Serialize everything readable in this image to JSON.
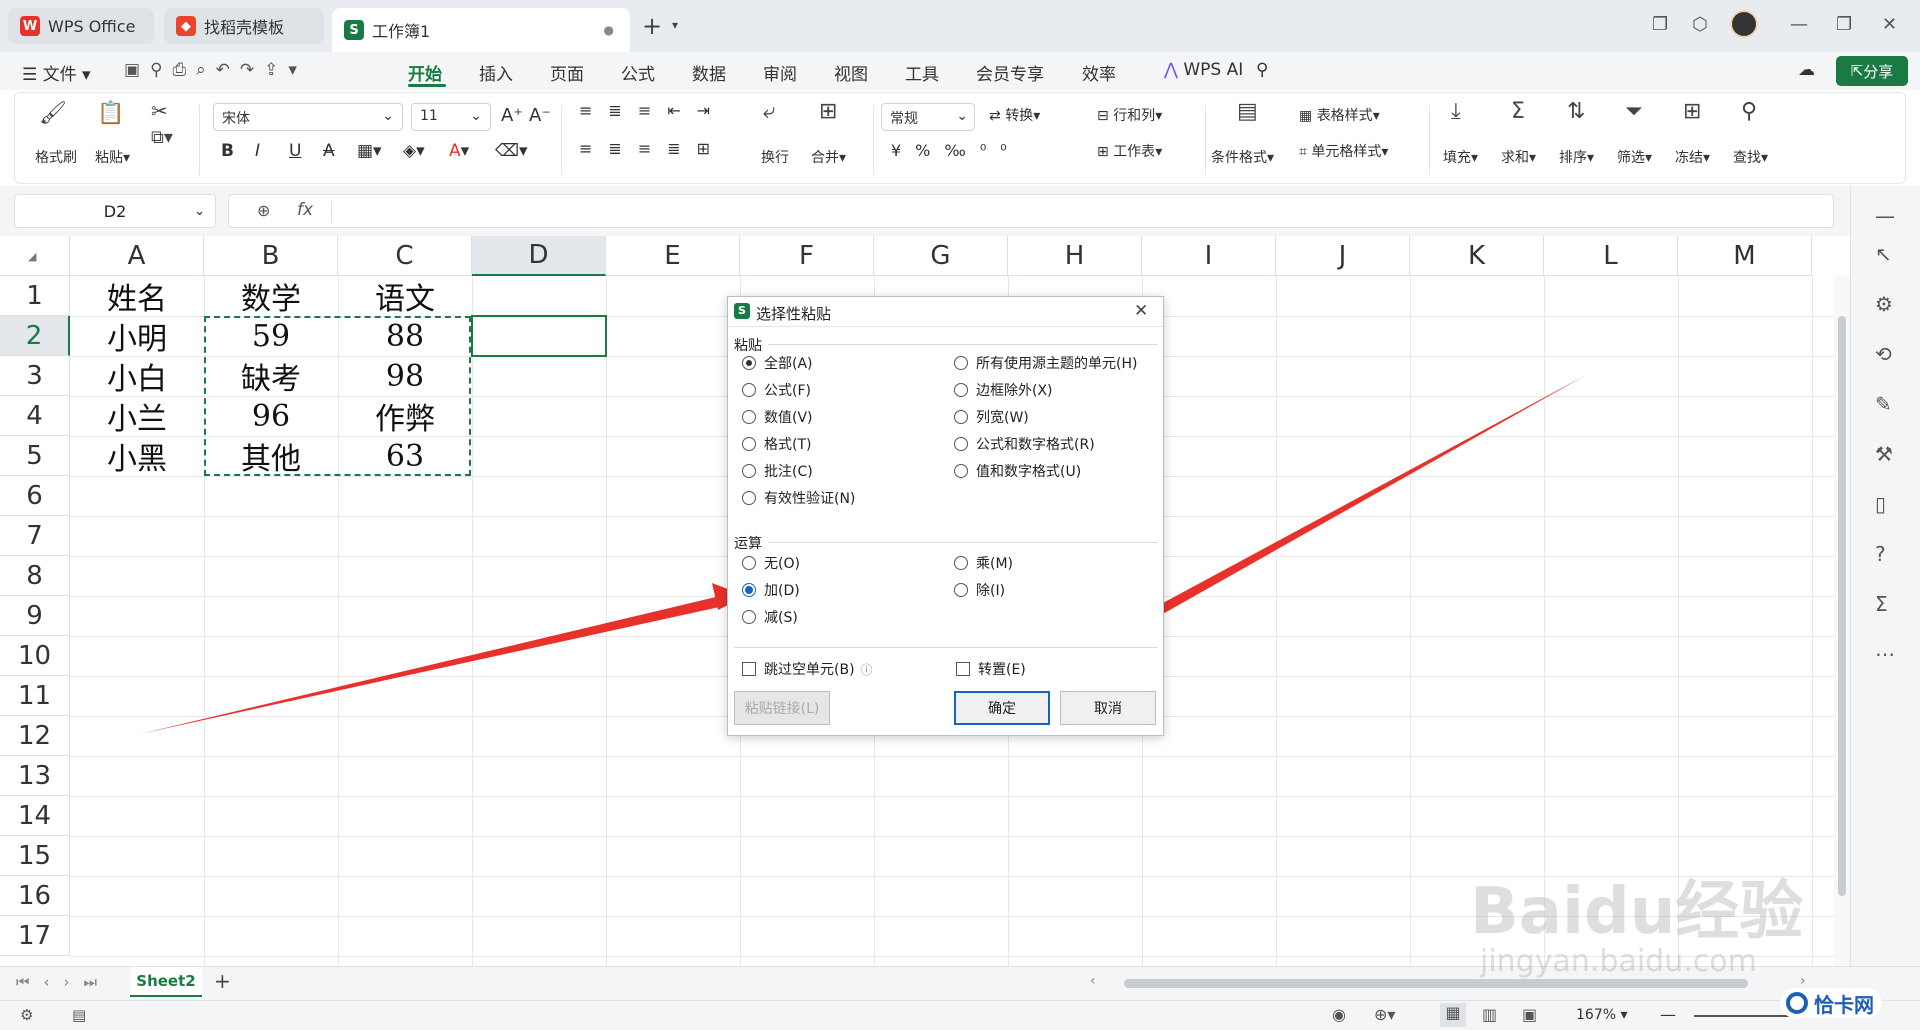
{
  "tabs": [
    {
      "label": "WPS Office",
      "icon": "wps-logo-icon"
    },
    {
      "label": "找稻壳模板",
      "icon": "docer-icon"
    },
    {
      "label": "工作簿1",
      "icon": "sheet-icon"
    }
  ],
  "menu": {
    "file": "文件",
    "items": [
      "开始",
      "插入",
      "页面",
      "公式",
      "数据",
      "审阅",
      "视图",
      "工具",
      "会员专享",
      "效率"
    ],
    "ai": "WPS AI",
    "share": "分享"
  },
  "ribbon": {
    "format_painter": "格式刷",
    "paste": "粘贴",
    "font_name": "宋体",
    "font_size": "11",
    "wrap": "换行",
    "merge": "合并",
    "number_format": "常规",
    "convert": "转换",
    "rows_cols": "行和列",
    "worksheet": "工作表",
    "cond_format": "条件格式",
    "table_style": "表格样式",
    "cell_style": "单元格样式",
    "fill": "填充",
    "sum": "求和",
    "sort": "排序",
    "filter": "筛选",
    "freeze": "冻结",
    "find": "查找"
  },
  "formula_bar": {
    "cell_ref": "D2",
    "fx": "fx"
  },
  "columns": [
    "A",
    "B",
    "C",
    "D",
    "E",
    "F",
    "G",
    "H",
    "I",
    "J",
    "K",
    "L",
    "M"
  ],
  "rows": [
    "1",
    "2",
    "3",
    "4",
    "5",
    "6",
    "7",
    "8",
    "9",
    "10",
    "11",
    "12",
    "13",
    "14",
    "15",
    "16",
    "17"
  ],
  "table": [
    [
      "姓名",
      "数学",
      "语文"
    ],
    [
      "小明",
      "59",
      "88"
    ],
    [
      "小白",
      "缺考",
      "98"
    ],
    [
      "小兰",
      "96",
      "作弊"
    ],
    [
      "小黑",
      "其他",
      "63"
    ]
  ],
  "dialog": {
    "title": "选择性粘贴",
    "paste_group": "粘贴",
    "paste_left": [
      "全部(A)",
      "公式(F)",
      "数值(V)",
      "格式(T)",
      "批注(C)",
      "有效性验证(N)"
    ],
    "paste_right": [
      "所有使用源主题的单元(H)",
      "边框除外(X)",
      "列宽(W)",
      "公式和数字格式(R)",
      "值和数字格式(U)"
    ],
    "op_group": "运算",
    "op_left": [
      "无(O)",
      "加(D)",
      "减(S)"
    ],
    "op_right": [
      "乘(M)",
      "除(I)"
    ],
    "skip_blanks": "跳过空单元(B)",
    "transpose": "转置(E)",
    "paste_link": "粘贴链接(L)",
    "ok": "确定",
    "cancel": "取消"
  },
  "sheet_tab": "Sheet2",
  "zoom": "167%",
  "watermark": {
    "main": "Baidu经验",
    "url": "jingyan.baidu.com",
    "corner": "恰卡网"
  },
  "colors": {
    "accent": "#1a7a43",
    "arrow": "#e8312a",
    "selection": "#1a7a43"
  }
}
